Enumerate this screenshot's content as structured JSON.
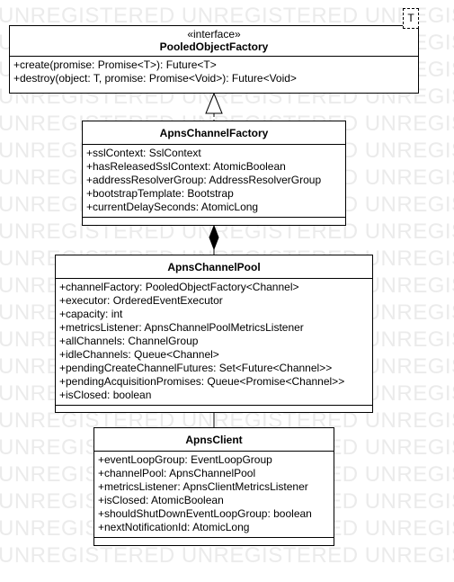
{
  "watermark": "UNREGISTERED",
  "diagram": {
    "pooled_object_factory": {
      "stereotype": "«interface»",
      "name": "PooledObjectFactory",
      "type_parameter": "T",
      "operations": [
        "+create(promise: Promise<T>): Future<T>",
        "+destroy(object: T, promise: Promise<Void>): Future<Void>"
      ]
    },
    "apns_channel_factory": {
      "name": "ApnsChannelFactory",
      "attributes": [
        "+sslContext: SslContext",
        "+hasReleasedSslContext: AtomicBoolean",
        "+addressResolverGroup: AddressResolverGroup",
        "+bootstrapTemplate: Bootstrap",
        "+currentDelaySeconds: AtomicLong"
      ]
    },
    "apns_channel_pool": {
      "name": "ApnsChannelPool",
      "attributes": [
        "+channelFactory: PooledObjectFactory<Channel>",
        "+executor: OrderedEventExecutor",
        "+capacity: int",
        "+metricsListener: ApnsChannelPoolMetricsListener",
        "+allChannels: ChannelGroup",
        "+idleChannels: Queue<Channel>",
        "+pendingCreateChannelFutures: Set<Future<Channel>>",
        "+pendingAcquisitionPromises: Queue<Promise<Channel>>",
        "+isClosed: boolean"
      ]
    },
    "apns_client": {
      "name": "ApnsClient",
      "attributes": [
        "+eventLoopGroup: EventLoopGroup",
        "+channelPool: ApnsChannelPool",
        "+metricsListener: ApnsClientMetricsListener",
        "+isClosed: AtomicBoolean",
        "+shouldShutDownEventLoopGroup: boolean",
        "+nextNotificationId: AtomicLong"
      ]
    }
  }
}
